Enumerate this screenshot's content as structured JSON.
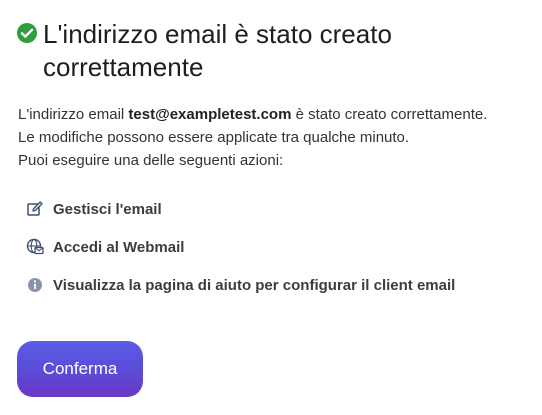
{
  "header": {
    "title_line1": "L'indirizzo email è stato creato",
    "title_line2": "correttamente",
    "success_icon": "check-circle-icon",
    "success_color": "#2e9e3f"
  },
  "message": {
    "prefix": "L'indirizzo email ",
    "email": "test@exampletest.com",
    "suffix": " è stato creato correttamente.",
    "line2": "Le modifiche possono essere applicate tra qualche minuto.",
    "line3": "Puoi eseguire una delle seguenti azioni:"
  },
  "actions": [
    {
      "label": "Gestisci l'email",
      "icon": "edit-icon"
    },
    {
      "label": "Accedi al Webmail",
      "icon": "webmail-globe-icon"
    },
    {
      "label": "Visualizza la pagina di aiuto per configurar il client email",
      "icon": "info-icon"
    }
  ],
  "buttons": {
    "confirm_label": "Conferma",
    "confirm_gradient": [
      "#5b5be6",
      "#6a37c7"
    ]
  }
}
